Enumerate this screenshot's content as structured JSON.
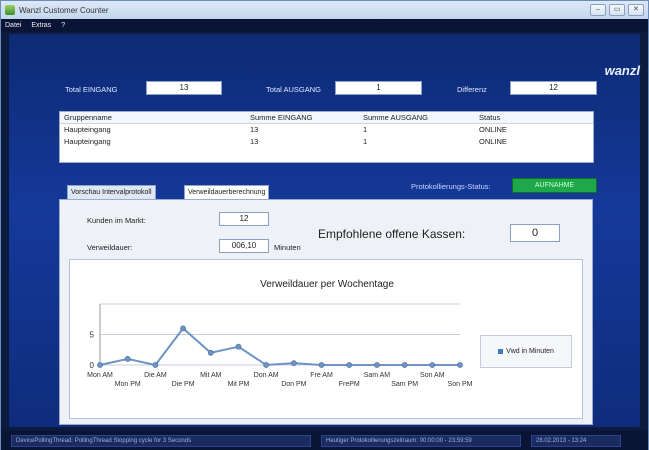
{
  "window": {
    "title": "Wanzl Customer Counter",
    "btn_min": "–",
    "btn_max": "▭",
    "btn_close": "✕"
  },
  "menu": {
    "items": [
      "Datei",
      "Extras",
      "?"
    ]
  },
  "brand": "wanzl",
  "totals": {
    "eingang_label": "Total EINGANG",
    "eingang_value": "13",
    "ausgang_label": "Total AUSGANG",
    "ausgang_value": "1",
    "differenz_label": "Differenz",
    "differenz_value": "12"
  },
  "grid": {
    "headers": [
      "Gruppenname",
      "Summe EINGANG",
      "Summe AUSGANG",
      "Status"
    ],
    "rows": [
      [
        "Haupteingang",
        "13",
        "1",
        "ONLINE"
      ],
      [
        "Haupteingang",
        "13",
        "1",
        "ONLINE"
      ]
    ]
  },
  "tabs": [
    "Vorschau Intervalprotokoll",
    "Verweildauerberechnung"
  ],
  "protokoll": {
    "label": "Protokollierungs-Status:",
    "status": "AUFNAHME",
    "status_color": "#1fa84a"
  },
  "panel": {
    "kunden_label": "Kunden im Markt:",
    "kunden_value": "12",
    "verweil_label": "Verweildauer:",
    "verweil_value": "006,10",
    "verweil_unit": "Minuten",
    "kassen_label": "Empfohlene offene Kassen:",
    "kassen_value": "0"
  },
  "chart_data": {
    "type": "line",
    "title": "Verweildauer  per Wochentage",
    "categories": [
      "Mon AM",
      "Mon PM",
      "Die AM",
      "Die PM",
      "Mit AM",
      "Mit PM",
      "Don AM",
      "Don PM",
      "Fre AM",
      "FrePM",
      "Sam AM",
      "Sam PM",
      "Son AM",
      "Son PM"
    ],
    "series": [
      {
        "name": "Vwd in Minuten",
        "values": [
          0,
          1,
          0,
          6,
          2,
          3,
          0,
          0.3,
          0,
          0,
          0,
          0,
          0,
          0
        ],
        "color": "#6e93c4"
      }
    ],
    "ylim": [
      0,
      10
    ],
    "yticks": [
      "0",
      "5"
    ],
    "legend": "right"
  },
  "statusbar": {
    "thread": "DevicePollingThread: PollingThread Stopping cycle for 3 Seconds",
    "protokoll": "Heutiger Protokollierungszeitraum: 00:00:00 - 23:59:59",
    "datetime": "28.02.2013 - 13:24"
  }
}
